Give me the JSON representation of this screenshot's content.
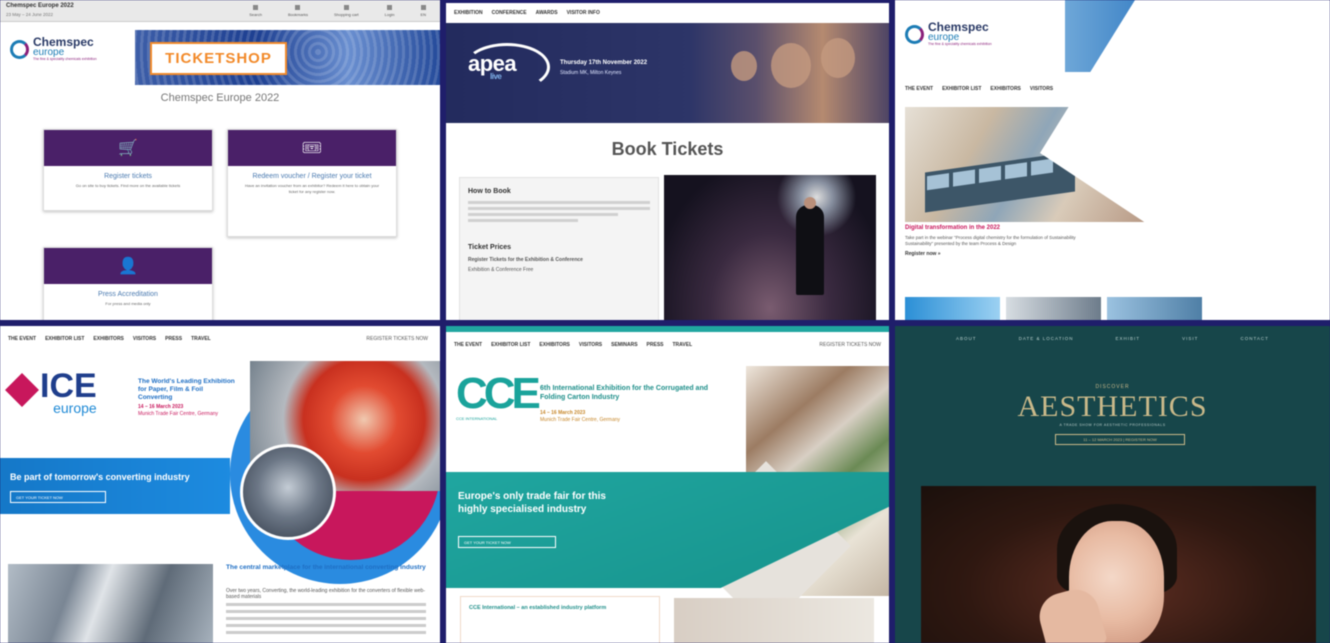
{
  "tile1": {
    "window_title": "Chemspec Europe 2022",
    "window_sub": "23 May – 24 June 2022",
    "toolbar_icons": [
      "Search",
      "Bookmarks",
      "Shopping cart",
      "Login",
      "EN"
    ],
    "logo_word1": "Chemspec",
    "logo_word2": "europe",
    "logo_tagline": "The fine & speciality chemicals exhibition",
    "ticketshop": "TICKETSHOP",
    "heading": "Chemspec Europe 2022",
    "cards": [
      {
        "icon": "🛒",
        "title": "Register tickets",
        "desc": "Go on site to buy tickets. Find more on the available tickets"
      },
      {
        "icon": "🎟",
        "title": "Redeem voucher / Register your ticket",
        "desc": "Have an invitation voucher from an exhibitor? Redeem it here to obtain your ticket for any register now."
      },
      {
        "icon": "👤",
        "title": "Press Accreditation",
        "desc": "For press and media only"
      }
    ]
  },
  "tile2": {
    "nav": [
      "EXHIBITION",
      "CONFERENCE",
      "AWARDS",
      "VISITOR INFO"
    ],
    "logo": "apea",
    "logo_sub": "live",
    "date": "Thursday 17th November 2022",
    "venue": "Stadium MK, Milton Keynes",
    "heading": "Book Tickets",
    "box_title1": "How to Book",
    "box_title2": "Ticket Prices",
    "box_line": "Register Tickets for the Exhibition & Conference",
    "box_line2": "Exhibition & Conference    Free"
  },
  "tile3": {
    "logo_word1": "Chemspec",
    "logo_word2": "europe",
    "logo_tagline": "The fine & speciality chemicals exhibition",
    "nav": [
      "THE EVENT",
      "EXHIBITOR LIST",
      "EXHIBITORS",
      "VISITORS"
    ],
    "article_title": "Digital transformation in the 2022",
    "article_text": "Take part in the webinar \"Process digital chemistry for the formulation of Sustainability Sustainability\" presented by the team Process & Design",
    "article_link": "Register now »"
  },
  "tile4": {
    "nav": [
      "THE EVENT",
      "EXHIBITOR LIST",
      "EXHIBITORS",
      "VISITORS",
      "PRESS",
      "TRAVEL"
    ],
    "nav_right": "REGISTER TICKETS NOW",
    "logo": "ICE",
    "logo_sub": "europe",
    "tagline": "The World's Leading Exhibition for Paper, Film & Foil Converting",
    "dates": "14 – 16 March 2023",
    "venue": "Munich Trade Fair Centre, Germany",
    "band_title": "Be part of tomorrow's converting industry",
    "band_button": "GET YOUR TICKET NOW",
    "promo_title": "The central marketplace for the international converting industry",
    "promo_text": "Over two years, Converting, the world-leading exhibition for the converters of flexible web-based materials"
  },
  "tile5": {
    "nav": [
      "THE EVENT",
      "EXHIBITOR LIST",
      "EXHIBITORS",
      "VISITORS",
      "SEMINARS",
      "PRESS",
      "TRAVEL"
    ],
    "nav_right": "REGISTER TICKETS NOW",
    "logo": "CCE",
    "logo_sub": "CCE INTERNATIONAL",
    "heading": "6th International Exhibition for the Corrugated and Folding Carton Industry",
    "dates": "14 – 16 March 2023",
    "venue": "Munich Trade Fair Centre, Germany",
    "band_title": "Europe's only trade fair for this highly specialised industry",
    "band_button": "GET YOUR TICKET NOW",
    "box_title": "CCE International – an established industry platform"
  },
  "tile6": {
    "nav": [
      "ABOUT",
      "DATE & LOCATION",
      "EXHIBIT",
      "VISIT",
      "CONTACT"
    ],
    "kicker": "DISCOVER",
    "title": "AESTHETICS",
    "tagline": "A TRADE SHOW FOR AESTHETIC PROFESSIONALS",
    "button": "11 – 12 MARCH 2023  |  REGISTER NOW"
  }
}
